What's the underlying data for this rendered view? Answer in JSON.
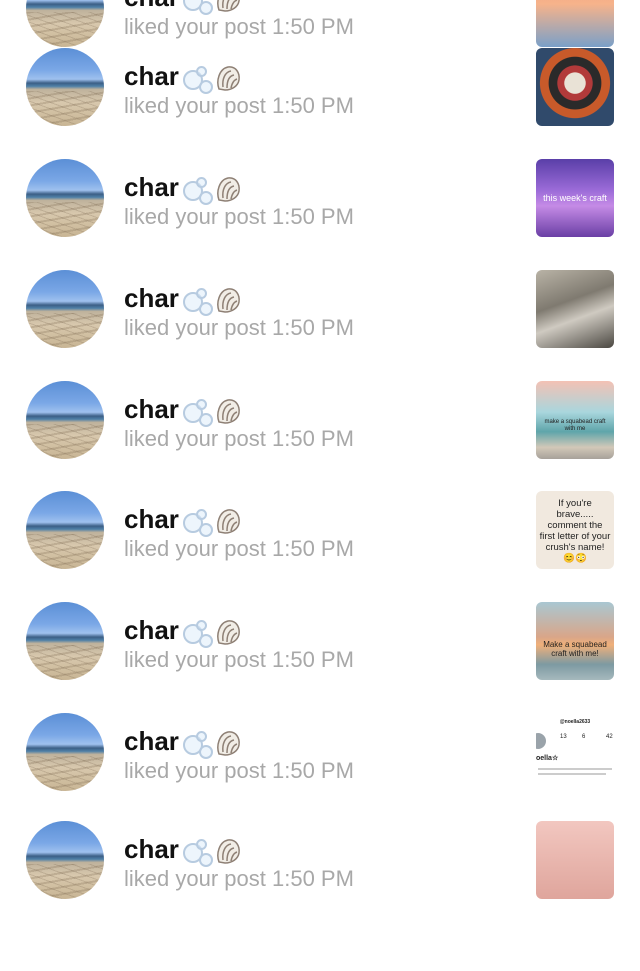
{
  "rows": [
    {
      "username": "char",
      "action": "liked your post",
      "time": "1:50 PM",
      "thumb_text": ""
    },
    {
      "username": "char",
      "action": "liked your post",
      "time": "1:50 PM",
      "thumb_text": ""
    },
    {
      "username": "char",
      "action": "liked your post",
      "time": "1:50 PM",
      "thumb_text": "this week's craft"
    },
    {
      "username": "char",
      "action": "liked your post",
      "time": "1:50 PM",
      "thumb_text": ""
    },
    {
      "username": "char",
      "action": "liked your post",
      "time": "1:50 PM",
      "thumb_text": "make a squabead craft with me"
    },
    {
      "username": "char",
      "action": "liked your post",
      "time": "1:50 PM",
      "thumb_text": "If you're brave..... comment the first letter of your crush's name! 😊😳"
    },
    {
      "username": "char",
      "action": "liked your post",
      "time": "1:50 PM",
      "thumb_text": "Make a squabead craft with me!"
    },
    {
      "username": "char",
      "action": "liked your post",
      "time": "1:50 PM",
      "thumb_text": "@noella2633"
    },
    {
      "username": "char",
      "action": "liked your post",
      "time": "1:50 PM",
      "thumb_text": ""
    }
  ],
  "thumb8": {
    "handle": "@noella2633",
    "stat1": "13",
    "stat2": "6",
    "stat3": "42",
    "name": "oella☆"
  },
  "icons": {
    "bubbles": "bubbles-icon",
    "shell": "spiral-shell-icon"
  }
}
